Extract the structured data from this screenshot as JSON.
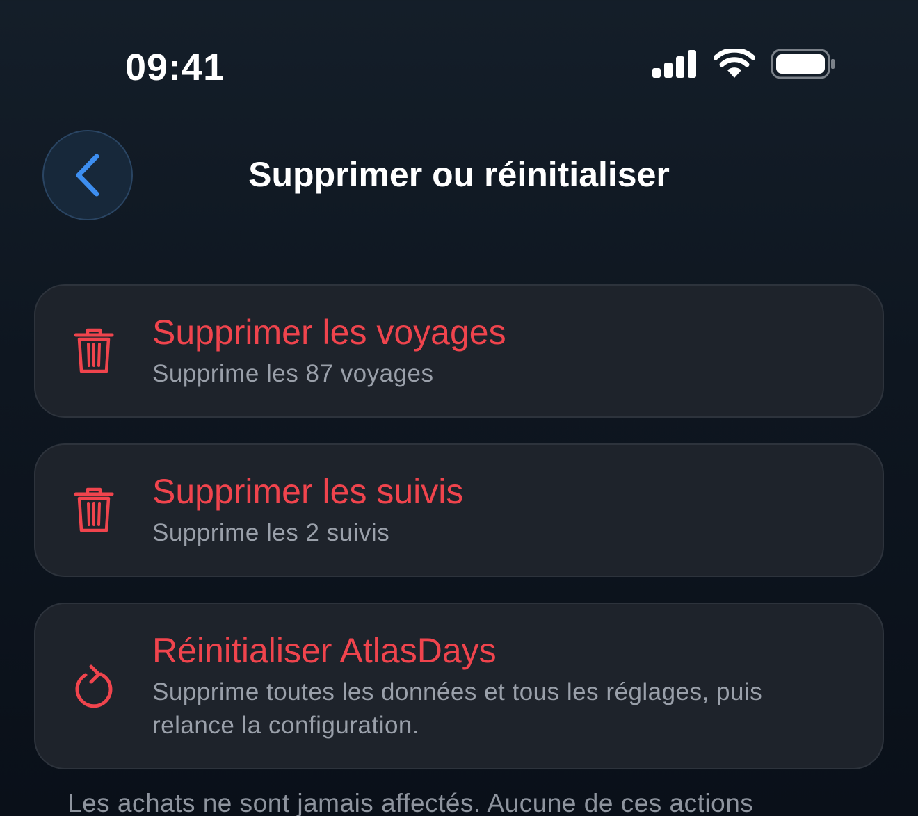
{
  "status_bar": {
    "time": "09:41"
  },
  "nav": {
    "title": "Supprimer ou réinitialiser"
  },
  "actions": [
    {
      "title": "Supprimer les voyages",
      "subtitle": "Supprime les 87 voyages",
      "icon": "trash-icon"
    },
    {
      "title": "Supprimer les suivis",
      "subtitle": "Supprime les 2 suivis",
      "icon": "trash-icon"
    },
    {
      "title": "Réinitialiser AtlasDays",
      "subtitle": "Supprime toutes les données et tous les réglages, puis relance la configuration.",
      "icon": "reset-arrow-icon"
    }
  ],
  "footer": {
    "note": "Les achats ne sont jamais affectés. Aucune de ces actions"
  },
  "colors": {
    "destructive": "#f0444d",
    "accent": "#3d8ef0",
    "card_background": "#1e232b"
  }
}
